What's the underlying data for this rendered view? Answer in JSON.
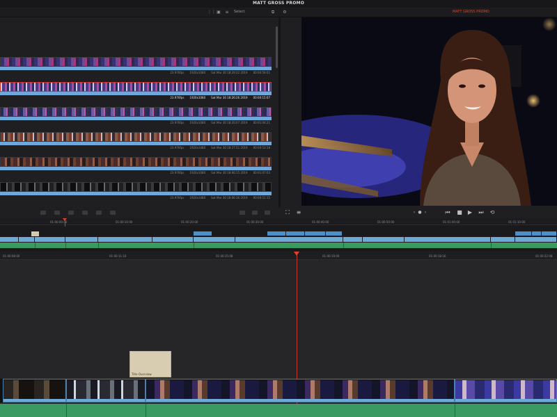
{
  "app": {
    "title": "MATT GROSS PROMO"
  },
  "header": {
    "select_label": "Select",
    "timeline_name": "MATT GROSS PROMO"
  },
  "clips": [
    {
      "fps": "23.976fps",
      "resolution": "1920x1080",
      "date": "Sat Mar 30 18:29:22 2019",
      "duration": "00:00:59:01"
    },
    {
      "fps": "23.976fps",
      "resolution": "1920x1080",
      "date": "Sat Mar 30 18:26:26 2019",
      "duration": "00:00:15:07"
    },
    {
      "fps": "23.976fps",
      "resolution": "1920x1080",
      "date": "Sat Mar 30 18:20:07 2019",
      "duration": "00:01:04:21"
    },
    {
      "fps": "23.976fps",
      "resolution": "1920x1080",
      "date": "Sat Mar 30 18:27:51 2019",
      "duration": "00:00:53:18"
    },
    {
      "fps": "23.976fps",
      "resolution": "1920x1080",
      "date": "Sat Mar 30 18:06:15 2019",
      "duration": "00:01:07:03"
    },
    {
      "fps": "23.976fps",
      "resolution": "1920x1080",
      "date": "Sat Mar 30 18:06:36 2019",
      "duration": "00:00:51:15"
    }
  ],
  "upper_timeline": {
    "timecodes": [
      "01:00:00:00",
      "01:00:10:00",
      "01:00:20:00",
      "01:00:30:00",
      "01:00:40:00",
      "01:00:50:00",
      "01:01:00:00",
      "01:01:10:00"
    ]
  },
  "lower_timeline": {
    "timecodes": [
      "01:00:08:00",
      "01:00:11:16",
      "01:00:15:08",
      "01:00:19:00",
      "01:00:18:16",
      "01:00:22:08"
    ],
    "title_clip_label": "Title Overview"
  },
  "icons": {
    "viewer_tool": "onscreen-controls-icon",
    "viewer_menu": "menu-icon",
    "prev": "jog-left-icon",
    "next": "jog-right-icon",
    "first": "skip-to-start-icon",
    "stop": "stop-icon",
    "play": "play-icon",
    "last": "skip-to-end-icon",
    "loop": "loop-icon"
  },
  "colors": {
    "accent": "#e04030",
    "audio": "#6fa7d8",
    "video_track": "#3b9a62"
  }
}
